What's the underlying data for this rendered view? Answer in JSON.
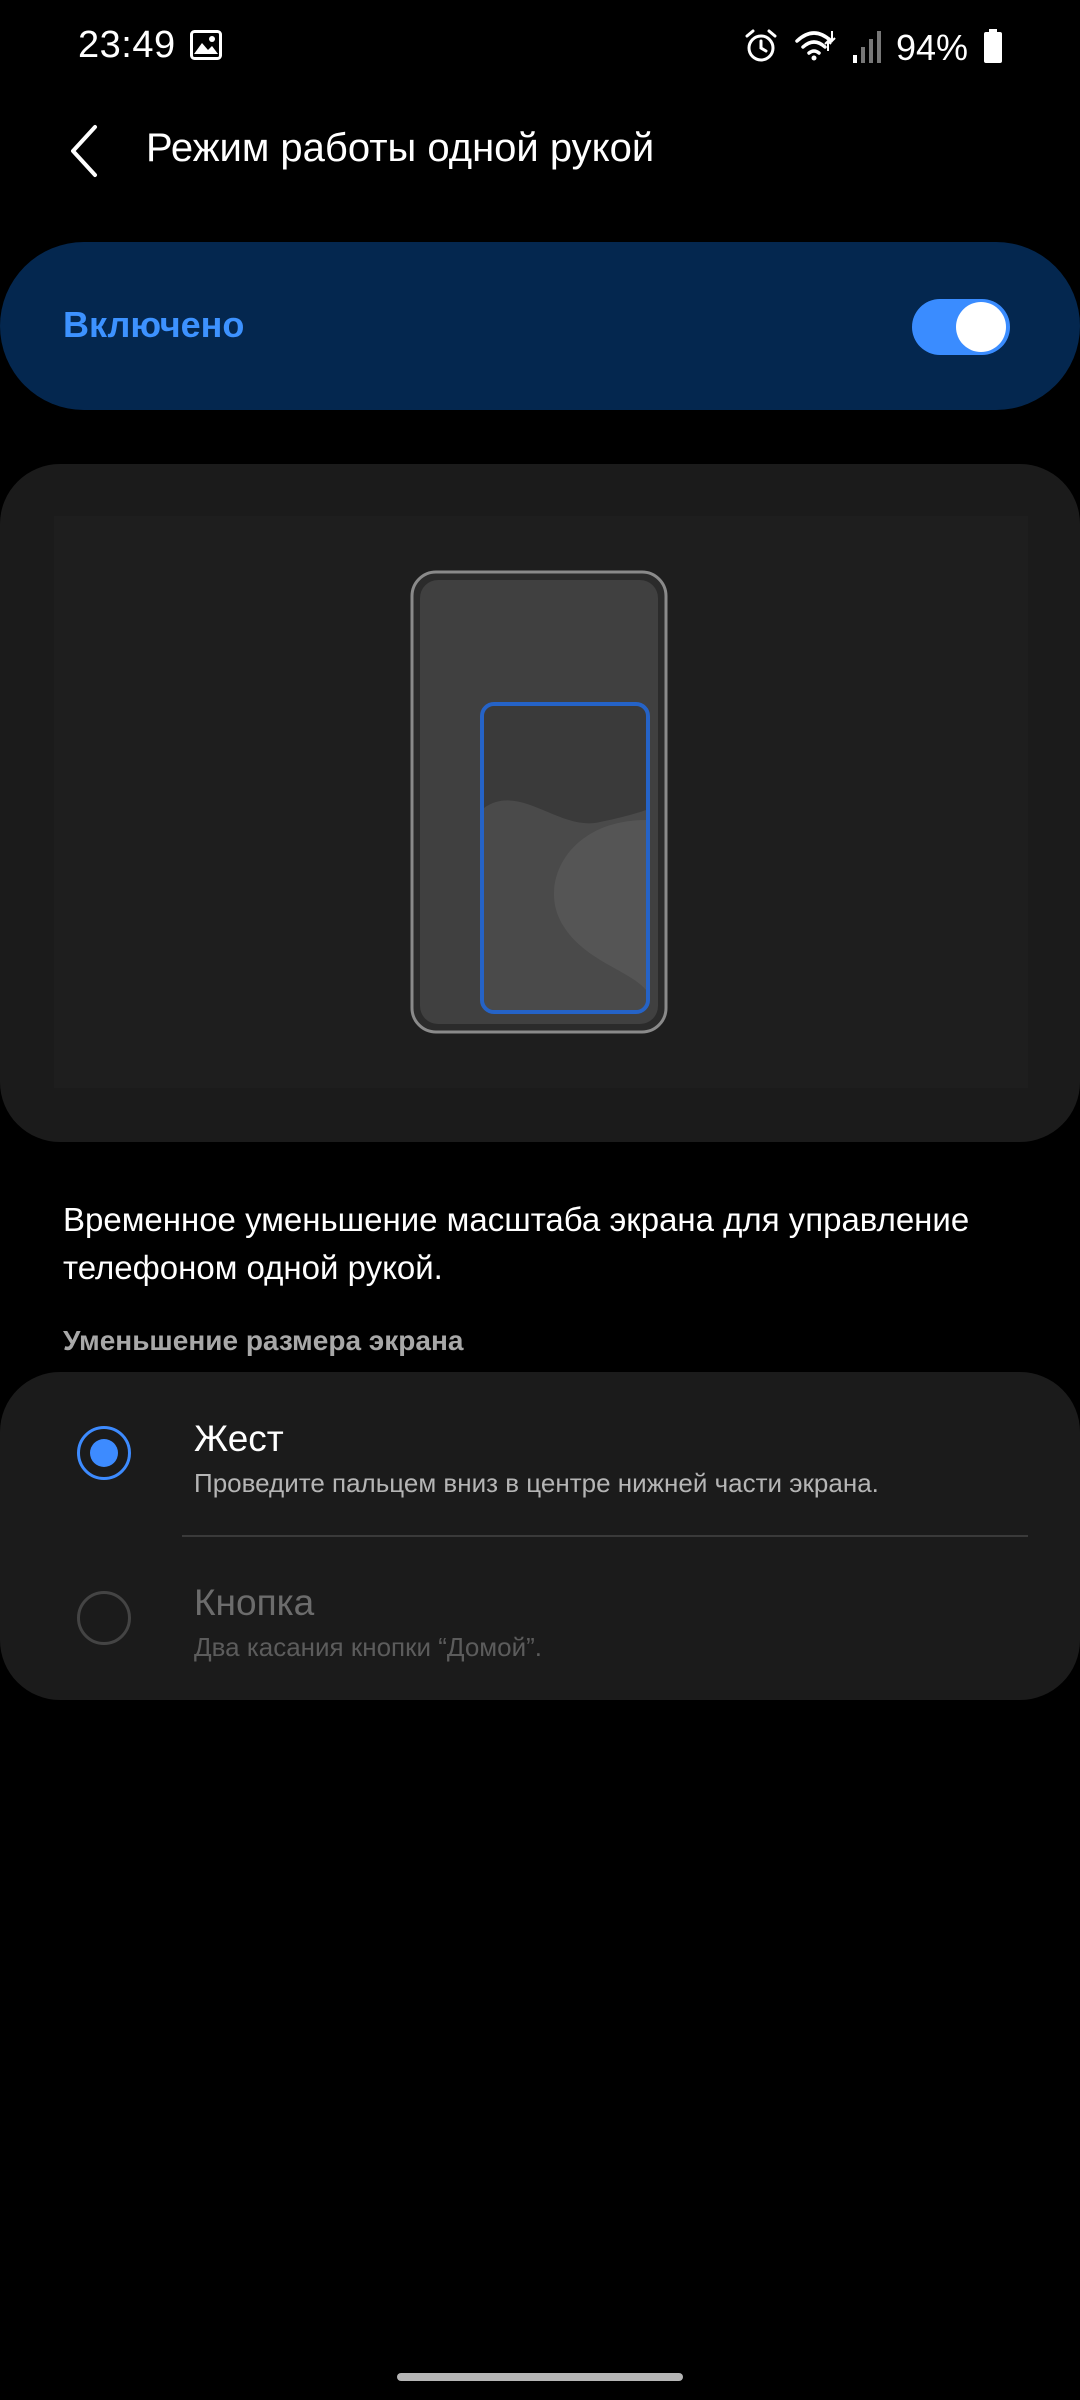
{
  "status_bar": {
    "time": "23:49",
    "icons": [
      "gallery-icon",
      "alarm-icon",
      "wifi-icon",
      "signal-icon",
      "battery-icon"
    ],
    "battery_text": "94%",
    "battery_level": 0.94
  },
  "header": {
    "back_icon": "chevron-left-icon",
    "title": "Режим работы одной рукой"
  },
  "master_switch": {
    "label": "Включено",
    "enabled": true,
    "accent_color": "#3d92ff",
    "background_color": "#04274f"
  },
  "illustration": {
    "description_icon": "one-handed-mode-illustration"
  },
  "description": "Временное уменьшение масштаба экрана для управление телефоном одной рукой.",
  "section": {
    "header": "Уменьшение размера экрана",
    "options": [
      {
        "title": "Жест",
        "subtitle": "Проведите пальцем вниз в центре нижней части экрана.",
        "selected": true
      },
      {
        "title": "Кнопка",
        "subtitle": "Два касания кнопки “Домой”.",
        "selected": false
      }
    ]
  }
}
